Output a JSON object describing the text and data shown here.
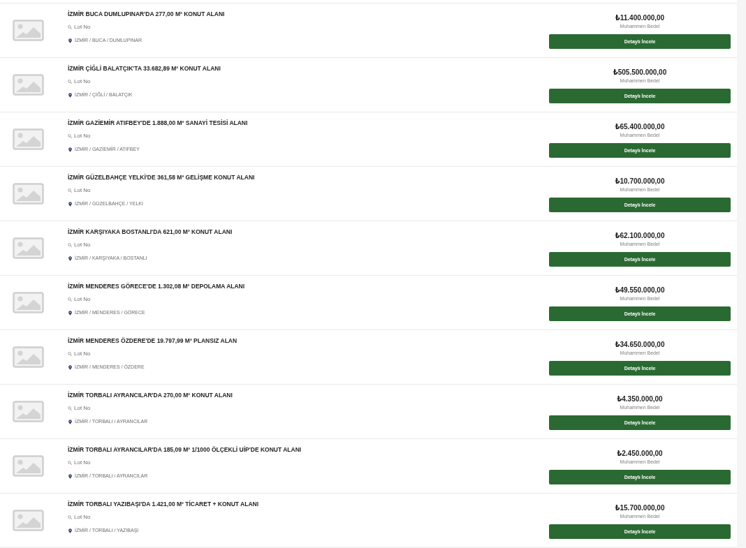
{
  "listings": [
    {
      "title": "İZMİR BUCA DUMLUPINAR'DA 277,00 M² KONUT ALANI",
      "lot_label": "Lot No",
      "location": "İZMİR / BUCA / DUMLUPINAR",
      "price": "₺11.400.000,00",
      "price_caption": "Muhammen Bedel",
      "button": "Detaylı İncele"
    },
    {
      "title": "İZMİR ÇİĞLİ BALATÇIK'TA 33.682,89 M² KONUT ALANI",
      "lot_label": "Lot No",
      "location": "İZMİR / ÇİĞLİ / BALATÇIK",
      "price": "₺505.500.000,00",
      "price_caption": "Muhammen Bedel",
      "button": "Detaylı İncele"
    },
    {
      "title": "İZMİR GAZİEMİR ATIFBEY'DE 1.888,00 M² SANAYİ TESİSİ ALANI",
      "lot_label": "Lot No",
      "location": "İZMİR / GAZİEMİR / ATIFBEY",
      "price": "₺65.400.000,00",
      "price_caption": "Muhammen Bedel",
      "button": "Detaylı İncele"
    },
    {
      "title": "İZMİR GÜZELBAHÇE YELKİ'DE 361,58 M² GELİŞME KONUT ALANI",
      "lot_label": "Lot No",
      "location": "İZMİR / GÜZELBAHÇE / YELKİ",
      "price": "₺10.700.000,00",
      "price_caption": "Muhammen Bedel",
      "button": "Detaylı İncele"
    },
    {
      "title": "İZMİR KARŞIYAKA BOSTANLI'DA 621,00 M² KONUT ALANI",
      "lot_label": "Lot No",
      "location": "İZMİR / KARŞIYAKA / BOSTANLI",
      "price": "₺62.100.000,00",
      "price_caption": "Muhammen Bedel",
      "button": "Detaylı İncele"
    },
    {
      "title": "İZMİR MENDERES GÖRECE'DE 1.302,08 M² DEPOLAMA ALANI",
      "lot_label": "Lot No",
      "location": "İZMİR / MENDERES / GÖRECE",
      "price": "₺49.550.000,00",
      "price_caption": "Muhammen Bedel",
      "button": "Detaylı İncele"
    },
    {
      "title": "İZMİR MENDERES ÖZDERE'DE 19.797,99 M² PLANSIZ ALAN",
      "lot_label": "Lot No",
      "location": "İZMİR / MENDERES / ÖZDERE",
      "price": "₺34.650.000,00",
      "price_caption": "Muhammen Bedel",
      "button": "Detaylı İncele"
    },
    {
      "title": "İZMİR TORBALI AYRANCILAR'DA 270,00 M² KONUT ALANI",
      "lot_label": "Lot No",
      "location": "İZMİR / TORBALI / AYRANCILAR",
      "price": "₺4.350.000,00",
      "price_caption": "Muhammen Bedel",
      "button": "Detaylı İncele"
    },
    {
      "title": "İZMİR TORBALI AYRANCILAR'DA 185,09 M² 1/1000 ÖLÇEKLİ UİP'DE KONUT ALANI",
      "lot_label": "Lot No",
      "location": "İZMİR / TORBALI / AYRANCILAR",
      "price": "₺2.450.000,00",
      "price_caption": "Muhammen Bedel",
      "button": "Detaylı İncele"
    },
    {
      "title": "İZMİR TORBALI YAZIBAŞI'DA 1.421,00 M² TİCARET + KONUT ALANI",
      "lot_label": "Lot No",
      "location": "İZMİR / TORBALI / YAZIBAŞI",
      "price": "₺15.700.000,00",
      "price_caption": "Muhammen Bedel",
      "button": "Detaylı İncele"
    }
  ]
}
